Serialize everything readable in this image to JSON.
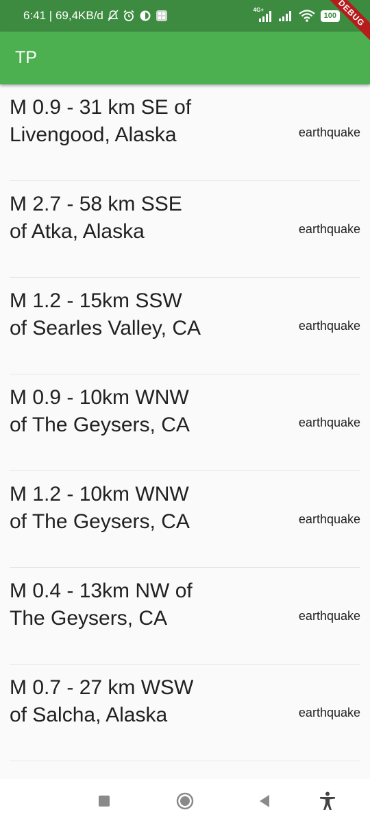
{
  "status_bar": {
    "time_speed": "6:41 | 69,4KB/d",
    "network_label": "4G+",
    "battery": "100"
  },
  "debug_banner": "DEBUG",
  "app_bar": {
    "title": "TP"
  },
  "earthquakes": [
    {
      "title": "M 0.9 - 31 km SE of Livengood, Alaska",
      "type": "earthquake"
    },
    {
      "title": "M 2.7 - 58 km SSE of Atka, Alaska",
      "type": "earthquake"
    },
    {
      "title": "M 1.2 - 15km SSW of Searles Valley, CA",
      "type": "earthquake"
    },
    {
      "title": "M 0.9 - 10km WNW of The Geysers, CA",
      "type": "earthquake"
    },
    {
      "title": "M 1.2 - 10km WNW of The Geysers, CA",
      "type": "earthquake"
    },
    {
      "title": "M 0.4 - 13km NW of The Geysers, CA",
      "type": "earthquake"
    },
    {
      "title": "M 0.7 - 27 km WSW of Salcha, Alaska",
      "type": "earthquake"
    }
  ],
  "nav_bar": {
    "icons": [
      "square-stop-icon",
      "home-circle-icon",
      "back-triangle-icon",
      "accessibility-icon"
    ]
  }
}
